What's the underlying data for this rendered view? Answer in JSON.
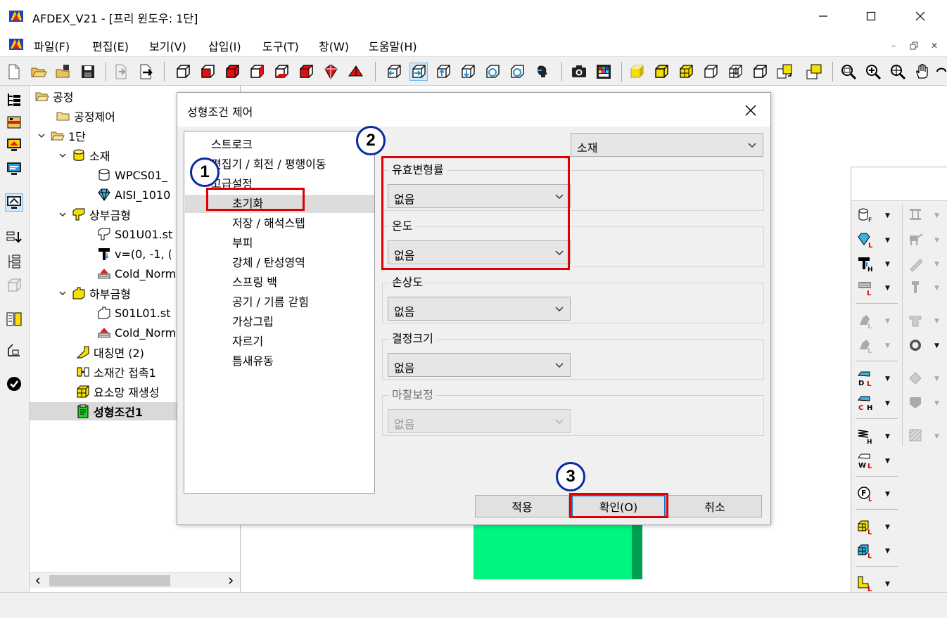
{
  "window": {
    "title": "AFDEX_V21 - [프리 윈도우: 1단]",
    "minimize": "—",
    "maximize": "☐",
    "close": "✕"
  },
  "menu": {
    "items": [
      "파일(F)",
      "편집(E)",
      "보기(V)",
      "삽입(I)",
      "도구(T)",
      "창(W)",
      "도움말(H)"
    ],
    "mdi_min": "–",
    "mdi_restore": "🗗",
    "mdi_close": "✕"
  },
  "tree": {
    "nodes": [
      {
        "label": "공정",
        "icon": "folder-open-icon"
      },
      {
        "label": "공정제어",
        "icon": "folder-icon"
      },
      {
        "label": "1단",
        "icon": "folder-open-icon"
      },
      {
        "label": "소재",
        "icon": "cylinder-icon"
      },
      {
        "label": "WPCS01_",
        "icon": "cylinder-outline-icon"
      },
      {
        "label": "AISI_1010",
        "icon": "diamond-icon"
      },
      {
        "label": "상부금형",
        "icon": "upper-die-icon"
      },
      {
        "label": "S01U01.st",
        "icon": "upper-die-outline-icon"
      },
      {
        "label": "v=(0, -1, (",
        "icon": "hammer-icon"
      },
      {
        "label": "Cold_Norm",
        "icon": "temperature-icon"
      },
      {
        "label": "하부금형",
        "icon": "lower-die-icon"
      },
      {
        "label": "S01L01.st",
        "icon": "lower-die-outline-icon"
      },
      {
        "label": "Cold_Norm",
        "icon": "temperature-icon"
      },
      {
        "label": "대칭면 (2)",
        "icon": "symmetry-plane-icon"
      },
      {
        "label": "소재간 접촉1",
        "icon": "contact-icon"
      },
      {
        "label": "요소망 재생성",
        "icon": "remesh-icon"
      },
      {
        "label": "성형조건1",
        "icon": "condition-icon"
      }
    ]
  },
  "dialog": {
    "title": "성형조건 제어",
    "list": [
      "스트로크",
      "편집기 / 회전 / 평행이동",
      "고급설정",
      "초기화",
      "저장 / 해석스텝",
      "부피",
      "강체 / 탄성영역",
      "스프링 백",
      "공기 / 기름 갇힘",
      "가상그립",
      "자르기",
      "틈새유동"
    ],
    "target_select": "소재",
    "groups": [
      {
        "label": "유효변형률",
        "value": "없음"
      },
      {
        "label": "온도",
        "value": "없음"
      },
      {
        "label": "손상도",
        "value": "없음"
      },
      {
        "label": "결정크기",
        "value": "없음"
      },
      {
        "label": "마찰보정",
        "value": "없음"
      }
    ],
    "buttons": {
      "apply": "적용",
      "ok": "확인(O)",
      "cancel": "취소"
    }
  },
  "annotations": {
    "step1": "1",
    "step2": "2",
    "step3": "3"
  },
  "colors": {
    "annotation_box": "#e00000",
    "badge_border": "#0a2aa0",
    "part_green": "#00f57f"
  }
}
